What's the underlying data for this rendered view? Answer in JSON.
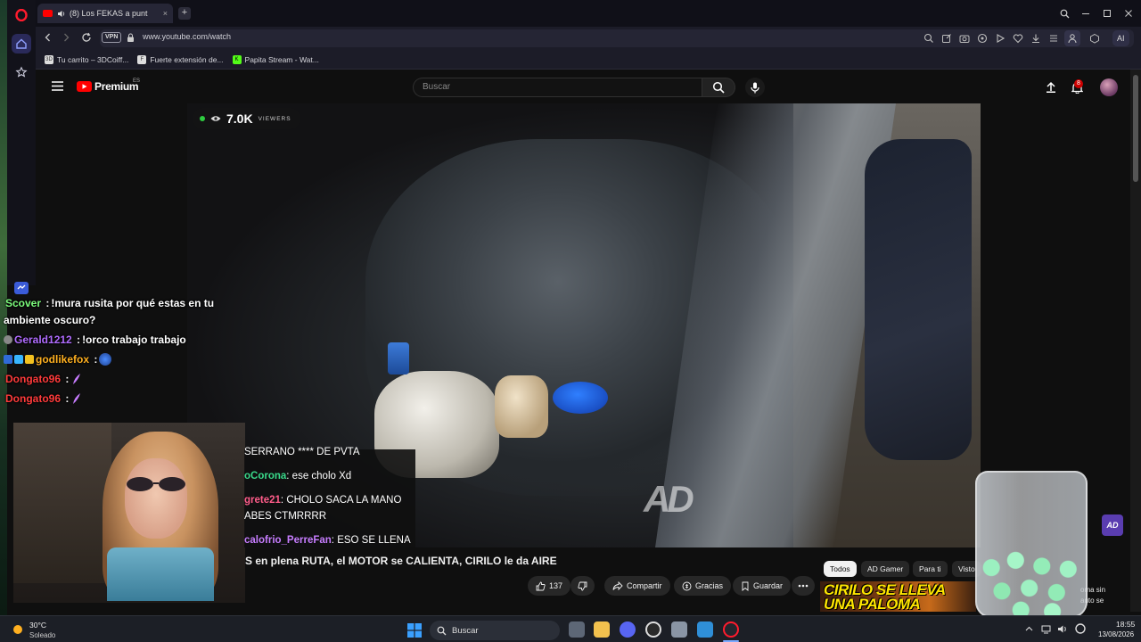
{
  "browser": {
    "tab_title": "(8) Los FEKAS a punt",
    "url": "www.youtube.com/watch",
    "vpn_label": "VPN",
    "ai_label": "AI",
    "bookmarks": [
      {
        "label": "Tu carrito – 3DCoiff...",
        "favicon": "3D"
      },
      {
        "label": "Fuerte extensión de...",
        "favicon": "F"
      },
      {
        "label": "Papita Stream - Wat...",
        "favicon": "K"
      }
    ]
  },
  "youtube": {
    "logo_text": "Premium",
    "country_code": "ES",
    "search_placeholder": "Buscar",
    "notification_count": "8"
  },
  "video": {
    "viewers_count": "7.0K",
    "viewers_label": "VIEWERS",
    "watermark": "AD",
    "title": "S en plena RUTA, el MOTOR se CALIENTA, CIRILO le da AIRE",
    "likes": "137",
    "share_label": "Compartir",
    "thanks_label": "Gracias",
    "save_label": "Guardar"
  },
  "overlay_chat": [
    {
      "user": "Scover",
      "user_color": "#7CFC7C",
      "message": "!mura rusita por qué estas en tu"
    },
    {
      "user": "",
      "user_color": "#ffffff",
      "message": "ambiente oscuro?"
    },
    {
      "user": "Gerald1212",
      "user_color": "#b06cff",
      "message": "!orco trabajo trabajo"
    },
    {
      "user": "godlikefox",
      "user_color": "#ffb020",
      "message": ""
    },
    {
      "user": "Dongato96",
      "user_color": "#ff3b3b",
      "message": ""
    },
    {
      "user": "Dongato96",
      "user_color": "#ff3b3b",
      "message": ""
    }
  ],
  "video_chat": [
    {
      "user": "",
      "user_color": "#ffffff",
      "message": "SERRANO **** DE PVTA"
    },
    {
      "user": "oCorona",
      "user_color": "#39d98a",
      "message": "ese cholo Xd"
    },
    {
      "user": "grete21",
      "user_color": "#ff5c8a",
      "message": "CHOLO SACA LA MANO"
    },
    {
      "user": "",
      "user_color": "#ffffff",
      "message": "ABES CTMRRRR"
    },
    {
      "user": "calofrio_PerreFan",
      "user_color": "#c77dff",
      "message": "ESO SE LLENA"
    }
  ],
  "filter_chips": [
    "Todos",
    "AD Gamer",
    "Para ti",
    "Visto"
  ],
  "recommendation": {
    "thumb_text_1": "CIRILO SE LLEVA",
    "thumb_text_2": "UNA PALOMA",
    "side_text_1": "oma sin",
    "side_text_2": "auto se"
  },
  "taskbar": {
    "temperature": "30°C",
    "weather": "Soleado",
    "search_label": "Buscar",
    "time": "18:55",
    "date": "13/08/2026"
  },
  "colors": {
    "youtube_red": "#ff0000",
    "live_green": "#2ecc40",
    "opera_red": "#ff1b2d"
  }
}
